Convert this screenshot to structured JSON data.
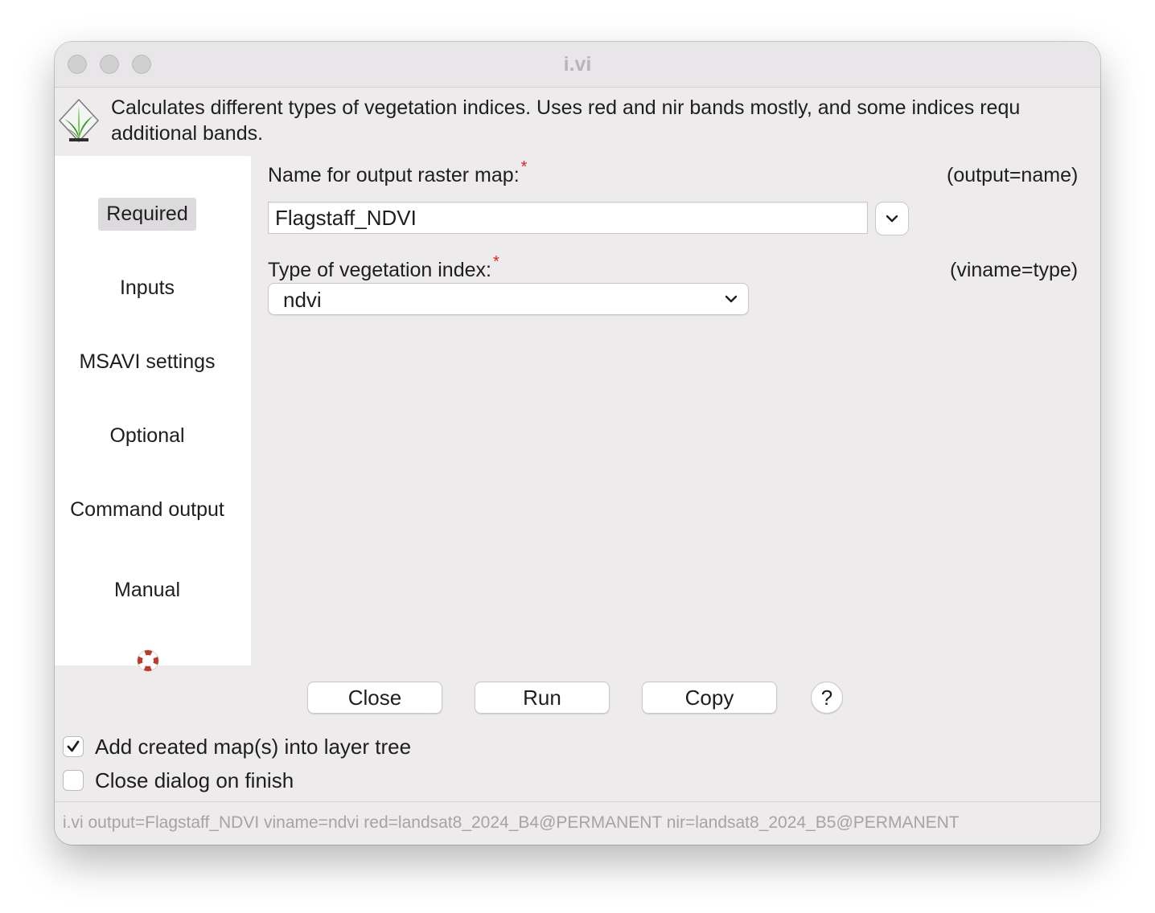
{
  "window": {
    "title": "i.vi"
  },
  "description": {
    "line1": "Calculates different types of vegetation indices. Uses red and nir bands mostly, and some indices requ",
    "line2": "additional bands."
  },
  "sidebar": {
    "items": [
      {
        "label": "Required",
        "selected": true
      },
      {
        "label": "Inputs"
      },
      {
        "label": "MSAVI settings"
      },
      {
        "label": "Optional"
      },
      {
        "label": "Command output"
      },
      {
        "label": "Manual"
      }
    ]
  },
  "form": {
    "output": {
      "label": "Name for output raster map:",
      "required_mark": "*",
      "hint": "(output=name)",
      "value": "Flagstaff_NDVI"
    },
    "viname": {
      "label": "Type of vegetation index:",
      "required_mark": "*",
      "hint": "(viname=type)",
      "value": "ndvi"
    }
  },
  "buttons": {
    "close": "Close",
    "run": "Run",
    "copy": "Copy",
    "help": "?"
  },
  "options": {
    "add_to_tree": {
      "label": "Add created map(s) into layer tree",
      "checked": true
    },
    "close_on_finish": {
      "label": "Close dialog on finish",
      "checked": false
    }
  },
  "status": {
    "command": "i.vi output=Flagstaff_NDVI viname=ndvi red=landsat8_2024_B4@PERMANENT nir=landsat8_2024_B5@PERMANENT"
  },
  "colors": {
    "required_star": "#e0251b",
    "window_bg": "#edebec",
    "sidebar_bg": "#ffffff"
  },
  "icons": {
    "module": "grass-leaf-icon",
    "manual": "lifebuoy-icon"
  }
}
